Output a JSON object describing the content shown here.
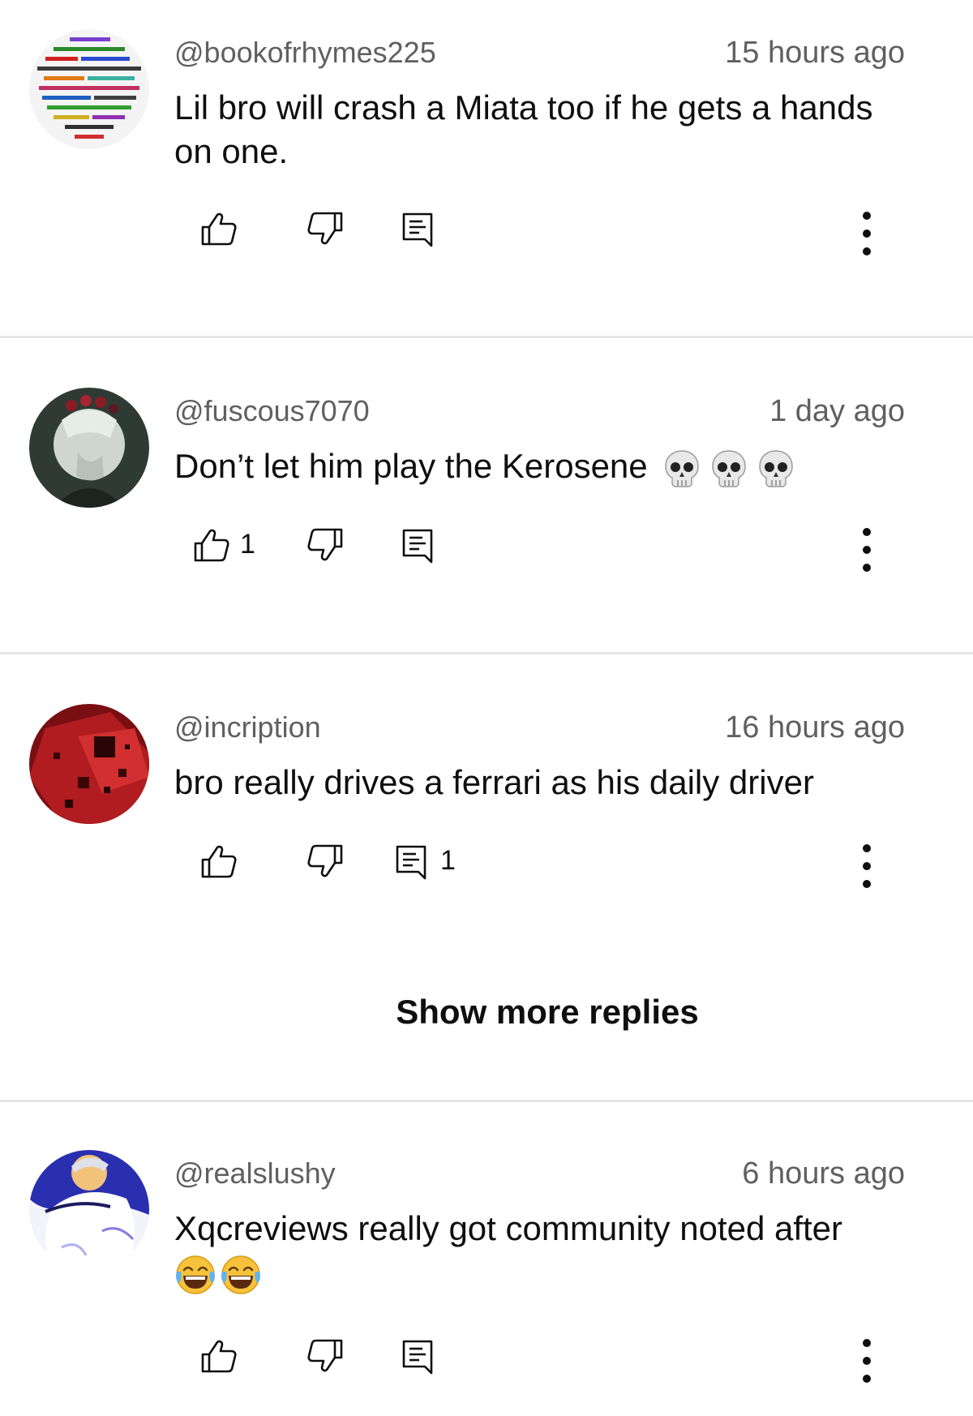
{
  "comments": [
    {
      "handle": "@bookofrhymes225",
      "time": "15 hours ago",
      "text": "Lil bro will crash a Miata too if he gets a hands on one.",
      "likes": "",
      "replies": ""
    },
    {
      "handle": "@fuscous7070",
      "time": "1 day ago",
      "text": "Don’t let him play the Kerosene",
      "emoji": "💀💀💀",
      "likes": "1",
      "replies": ""
    },
    {
      "handle": "@incription",
      "time": "16 hours ago",
      "text": "bro really drives a ferrari as his daily driver",
      "likes": "",
      "replies": "1"
    },
    {
      "handle": "@realslushy",
      "time": "6 hours ago",
      "text": "Xqcreviews really got community noted after",
      "emoji": "😂😂",
      "likes": "",
      "replies": ""
    }
  ],
  "show_more_replies": "Show more replies",
  "icons": {
    "like": "thumbs-up-icon",
    "dislike": "thumbs-down-icon",
    "reply": "reply-icon",
    "more": "more-vertical-icon",
    "skull": "skull-emoji",
    "laugh": "tears-of-joy-emoji"
  },
  "colors": {
    "text_primary": "#0f0f0f",
    "text_secondary": "#606060",
    "divider": "#e5e5e5"
  }
}
